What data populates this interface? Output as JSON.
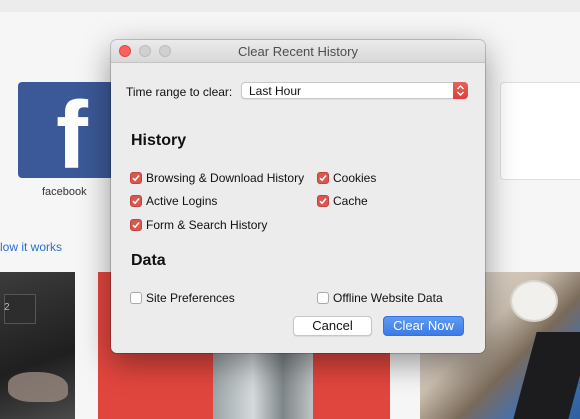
{
  "background": {
    "tile_caption": "facebook",
    "tile_letter": "f",
    "link_text": "low it works",
    "photo_number": "2"
  },
  "dialog": {
    "title": "Clear Recent History",
    "time_range": {
      "label": "Time range to clear:",
      "value": "Last Hour"
    },
    "history": {
      "heading": "History",
      "items": [
        {
          "label": "Browsing & Download History",
          "checked": true
        },
        {
          "label": "Active Logins",
          "checked": true
        },
        {
          "label": "Form & Search History",
          "checked": true
        },
        {
          "label": "Cookies",
          "checked": true
        },
        {
          "label": "Cache",
          "checked": true
        }
      ]
    },
    "data": {
      "heading": "Data",
      "items": [
        {
          "label": "Site Preferences",
          "checked": false
        },
        {
          "label": "Offline Website Data",
          "checked": false
        }
      ]
    },
    "buttons": {
      "cancel": "Cancel",
      "clear": "Clear Now"
    }
  },
  "colors": {
    "accent_checkbox": "#d9574f",
    "primary_button": "#3b7be6",
    "facebook_blue": "#3b5998"
  }
}
